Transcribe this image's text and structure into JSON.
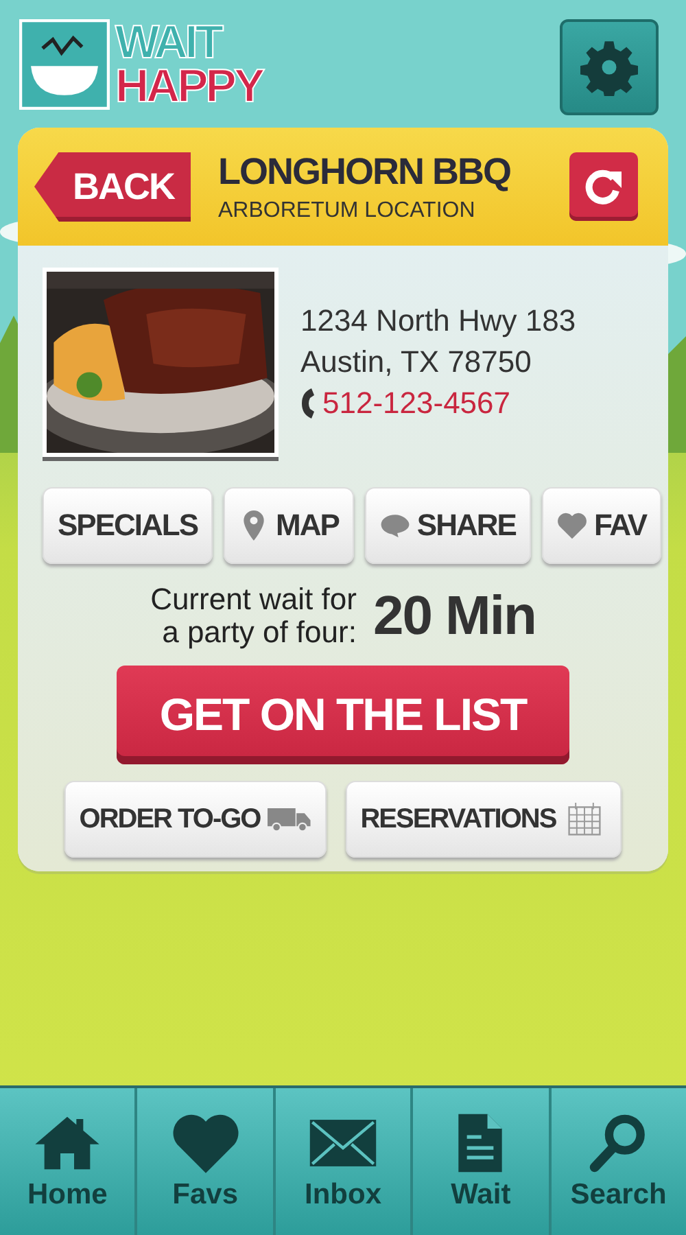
{
  "logo": {
    "line_1": "WAIT",
    "line_2": "HAPPY"
  },
  "header": {
    "back": "BACK",
    "title": "LONGHORN BBQ",
    "subtitle": "ARBORETUM LOCATION"
  },
  "restaurant": {
    "address_1": "1234 North Hwy 183",
    "address_2": "Austin, TX 78750",
    "phone": "512-123-4567"
  },
  "actions": [
    {
      "label": "SPECIALS"
    },
    {
      "label": "MAP"
    },
    {
      "label": "SHARE"
    },
    {
      "label": "FAV"
    }
  ],
  "wait": {
    "caption_1": "Current wait for",
    "caption_2": "a party of four:",
    "time": "20 Min"
  },
  "primary_button": "GET ON THE LIST",
  "secondary_buttons": [
    {
      "label": "ORDER TO-GO"
    },
    {
      "label": "RESERVATIONS"
    }
  ],
  "tabs": [
    {
      "label": "Home"
    },
    {
      "label": "Favs"
    },
    {
      "label": "Inbox"
    },
    {
      "label": "Wait"
    },
    {
      "label": "Search"
    }
  ]
}
